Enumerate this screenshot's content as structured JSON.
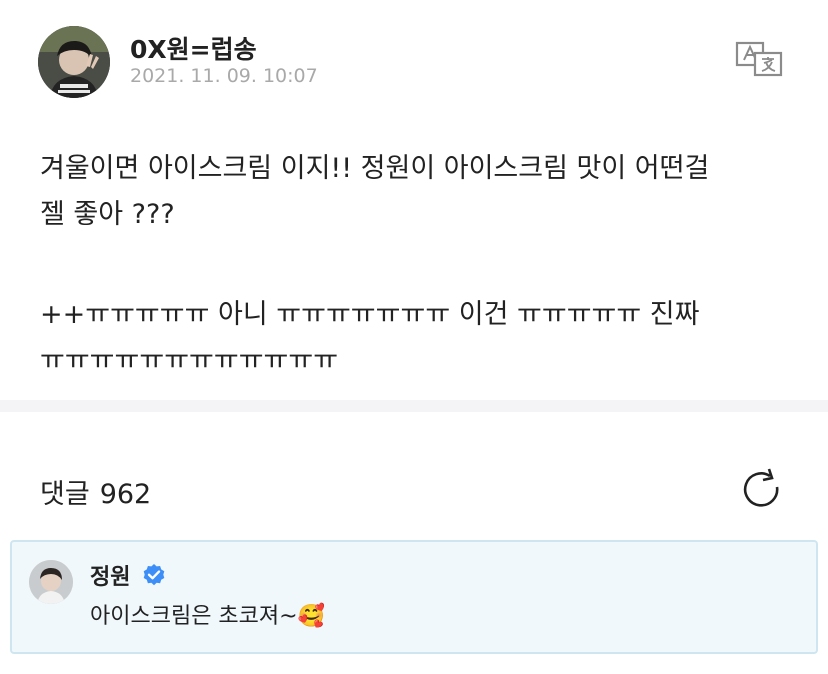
{
  "post": {
    "author": "0X원=럽송",
    "timestamp": "2021. 11. 09. 10:07",
    "body_lines": [
      "겨울이면 아이스크림 이지!!  정원이 아이스크림 맛이 어떤걸",
      "젤 좋아 ???",
      "++ㅠㅠㅠㅠㅠ 아니 ㅠㅠㅠㅠㅠㅠㅠ 이건 ㅠㅠㅠㅠㅠ 진짜",
      "ㅠㅠㅠㅠㅠㅠㅠㅠㅠㅠㅠㅠ"
    ],
    "translate_icon": "translate-icon"
  },
  "comments": {
    "label": "댓글",
    "count": "962",
    "refresh_icon": "refresh-icon"
  },
  "pinned_comment": {
    "author": "정원",
    "verified": true,
    "text": "아이스크림은 초코져~",
    "emoji": "🥰"
  },
  "colors": {
    "background": "#ffffff",
    "text": "#222222",
    "muted": "#a9a9a9",
    "divider": "#f4f4f6",
    "pinned_bg": "#f0f8fc",
    "pinned_border": "#cfe6f1",
    "verified": "#3e8ef7"
  }
}
